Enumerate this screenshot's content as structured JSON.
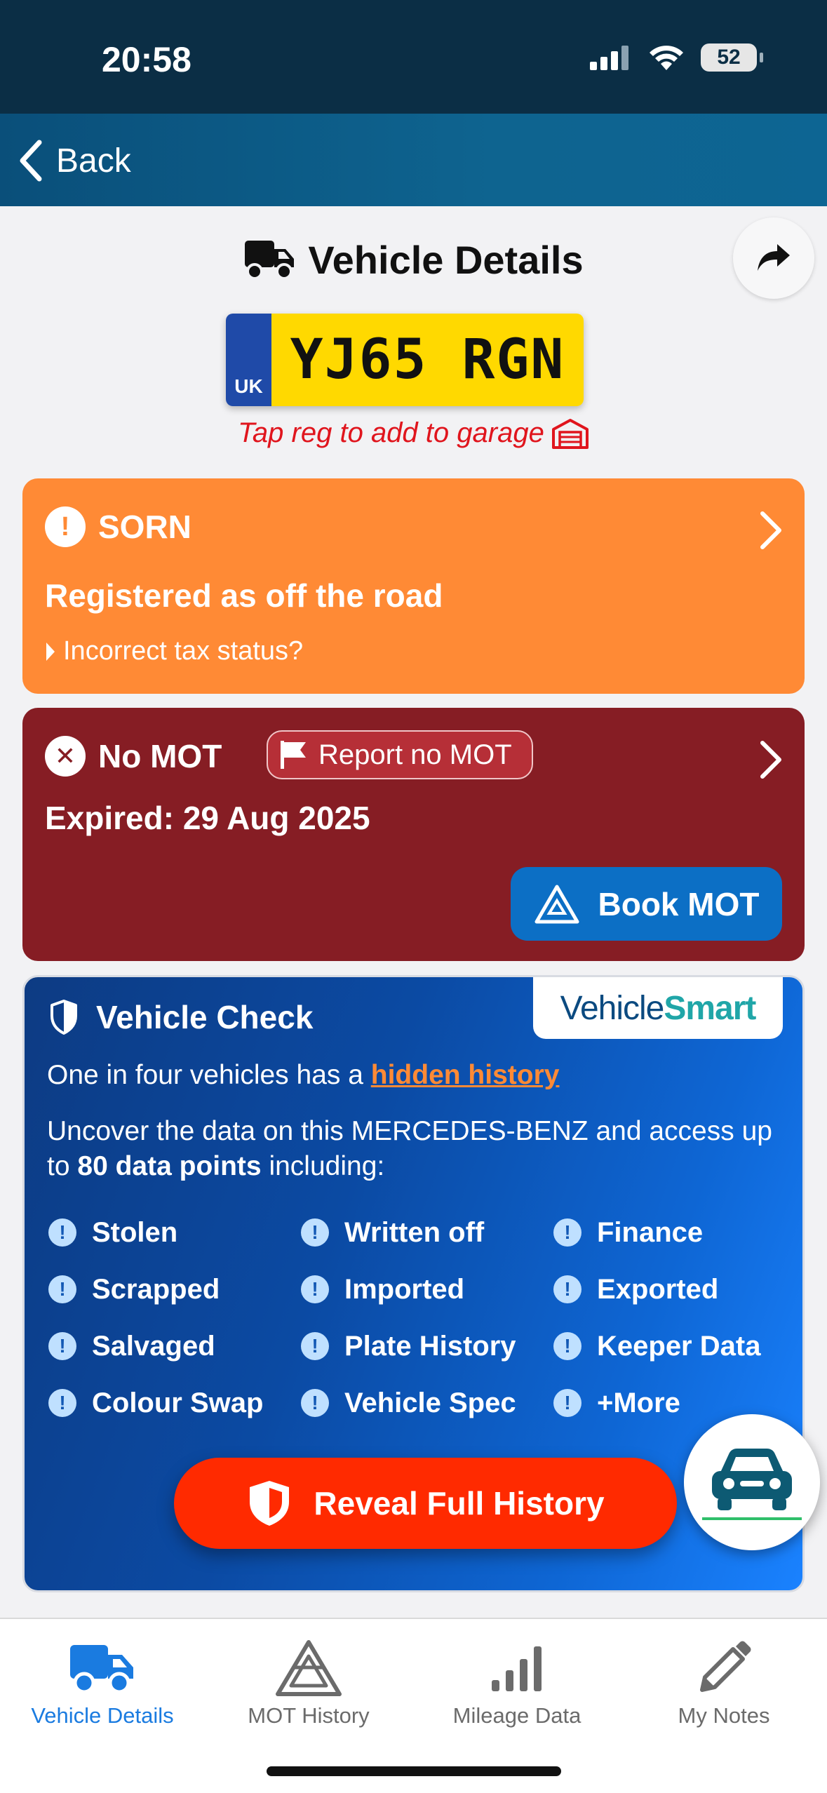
{
  "status_bar": {
    "time": "20:58",
    "battery": "52"
  },
  "nav": {
    "back_label": "Back"
  },
  "header": {
    "title": "Vehicle Details"
  },
  "plate": {
    "country": "UK",
    "registration": "YJ65 RGN",
    "hint": "Tap reg to add to garage"
  },
  "sorn": {
    "title": "SORN",
    "subtitle": "Registered as off the road",
    "link": "Incorrect tax status?"
  },
  "mot": {
    "title": "No MOT",
    "report_label": "Report no MOT",
    "expired": "Expired: 29 Aug 2025",
    "book_label": "Book MOT"
  },
  "check": {
    "logo_part1": "Vehicle",
    "logo_part2": "Smart",
    "title": "Vehicle Check",
    "line1_prefix": "One in four vehicles has a ",
    "line1_link": "hidden history",
    "line2_prefix": "Uncover the data on this MERCEDES-BENZ and access up to ",
    "line2_bold": "80 data points",
    "line2_suffix": " including:",
    "items": [
      "Stolen",
      "Written off",
      "Finance",
      "Scrapped",
      "Imported",
      "Exported",
      "Salvaged",
      "Plate History",
      "Keeper Data",
      "Colour Swap",
      "Vehicle Spec",
      "+More"
    ],
    "reveal_label": "Reveal Full History"
  },
  "tabs": [
    {
      "label": "Vehicle Details",
      "icon": "truck-icon",
      "active": true
    },
    {
      "label": "MOT History",
      "icon": "mot-triangle-icon",
      "active": false
    },
    {
      "label": "Mileage Data",
      "icon": "bar-chart-icon",
      "active": false
    },
    {
      "label": "My Notes",
      "icon": "pencil-icon",
      "active": false
    }
  ],
  "colors": {
    "sorn": "#ff8a35",
    "mot": "#861d24",
    "accent": "#1a7be0",
    "reveal": "#ff2a00"
  }
}
